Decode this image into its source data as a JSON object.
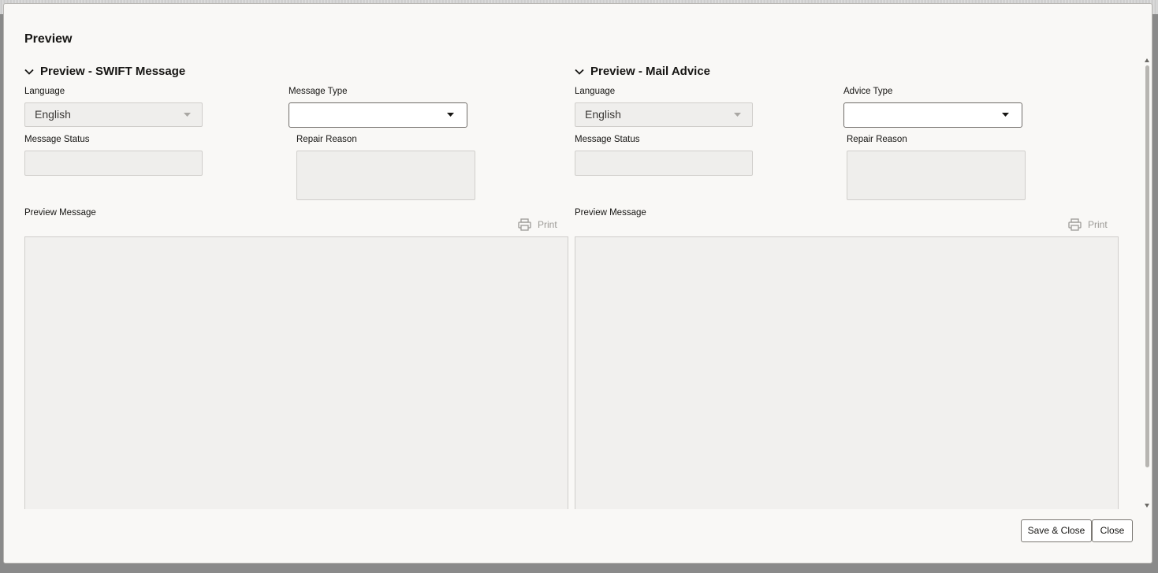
{
  "dialog": {
    "title": "Preview"
  },
  "swift": {
    "section_title": "Preview - SWIFT Message",
    "language_label": "Language",
    "language_value": "English",
    "message_type_label": "Message Type",
    "message_type_value": "",
    "message_status_label": "Message Status",
    "message_status_value": "",
    "repair_reason_label": "Repair Reason",
    "repair_reason_value": "",
    "preview_message_label": "Preview Message",
    "print_label": "Print",
    "preview_message_value": ""
  },
  "mail": {
    "section_title": "Preview - Mail Advice",
    "language_label": "Language",
    "language_value": "English",
    "advice_type_label": "Advice Type",
    "advice_type_value": "",
    "message_status_label": "Message Status",
    "message_status_value": "",
    "repair_reason_label": "Repair Reason",
    "repair_reason_value": "",
    "preview_message_label": "Preview Message",
    "print_label": "Print",
    "preview_message_value": ""
  },
  "footer": {
    "save_close_label": "Save & Close",
    "close_label": "Close"
  },
  "icons": {
    "section_toggle": "chevron-down-icon",
    "dropdown": "caret-down-icon",
    "print": "printer-icon"
  },
  "colors": {
    "modal_bg": "#f9f8f6",
    "readonly_field_bg": "#efeeec",
    "disabled_text": "#9c9a96",
    "text": "#161513"
  }
}
